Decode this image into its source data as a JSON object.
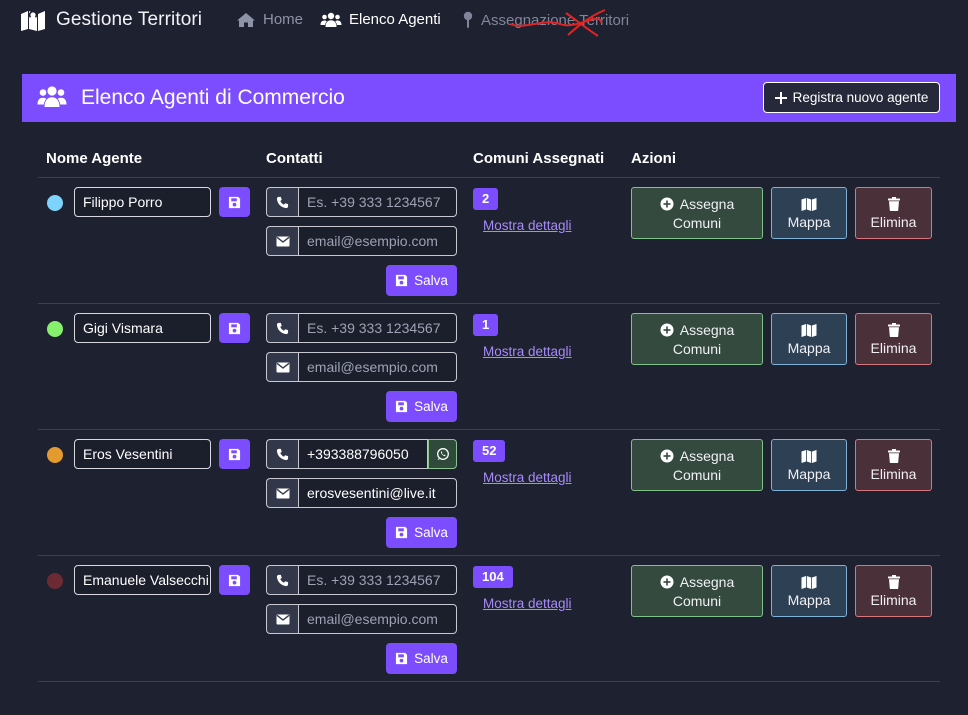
{
  "navbar": {
    "brand": "Gestione Territori",
    "links": [
      {
        "label": "Home",
        "icon": "home-icon"
      },
      {
        "label": "Elenco Agenti",
        "icon": "users-icon"
      },
      {
        "label": "Assegnazione Territori",
        "icon": "pin-icon"
      }
    ]
  },
  "header": {
    "title": "Elenco Agenti di Commercio",
    "register_button": "Registra nuovo agente"
  },
  "table": {
    "columns": [
      "Nome Agente",
      "Contatti",
      "Comuni Assegnati",
      "Azioni"
    ],
    "rows": [
      {
        "name": "Filippo Porro",
        "color": "#7dd3fc",
        "phone": "",
        "phone_placeholder": "Es. +39 333 1234567",
        "email": "",
        "email_placeholder": "email@esempio.com",
        "comuni_count": "2",
        "has_whatsapp": false
      },
      {
        "name": "Gigi Vismara",
        "color": "#86ef6c",
        "phone": "",
        "phone_placeholder": "Es. +39 333 1234567",
        "email": "",
        "email_placeholder": "email@esempio.com",
        "comuni_count": "1",
        "has_whatsapp": false
      },
      {
        "name": "Eros Vesentini",
        "color": "#e39a2e",
        "phone": "+393388796050",
        "phone_placeholder": "Es. +39 333 1234567",
        "email": "erosvesentini@live.it",
        "email_placeholder": "email@esempio.com",
        "comuni_count": "52",
        "has_whatsapp": true
      },
      {
        "name": "Emanuele Valsecchi",
        "color": "#6b2a34",
        "phone": "",
        "phone_placeholder": "Es. +39 333 1234567",
        "email": "",
        "email_placeholder": "email@esempio.com",
        "comuni_count": "104",
        "has_whatsapp": false
      }
    ],
    "labels": {
      "save": "Salva",
      "details": "Mostra dettagli",
      "assign_line1": "Assegna",
      "assign_line2": "Comuni",
      "map": "Mappa",
      "delete": "Elimina"
    }
  },
  "colors": {
    "accent": "#7c4dff",
    "background": "#1e2130"
  }
}
